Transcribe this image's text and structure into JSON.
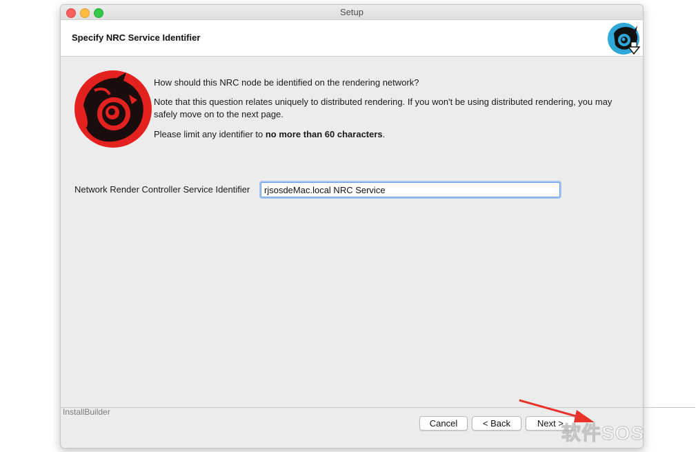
{
  "window": {
    "title": "Setup"
  },
  "header": {
    "title": "Specify NRC Service Identifier"
  },
  "body": {
    "question": "How should this NRC node be identified on the rendering network?",
    "note": "Note that this question relates uniquely to distributed rendering. If you won't be using distributed rendering, you may safely move on to the next page.",
    "limit_prefix": "Please limit any identifier to ",
    "limit_bold": "no more than 60 characters",
    "limit_suffix": "."
  },
  "field": {
    "label": "Network Render Controller Service Identifier",
    "value": "rjsosdeMac.local NRC Service"
  },
  "footer": {
    "brand": "InstallBuilder",
    "cancel_label": "Cancel",
    "back_label": "< Back",
    "next_label": "Next >"
  },
  "watermark": {
    "text": "软件SOS"
  },
  "colors": {
    "logo_red": "#e3211e",
    "logo_blue": "#2ea7d9",
    "arrow_red": "#e8332a"
  }
}
